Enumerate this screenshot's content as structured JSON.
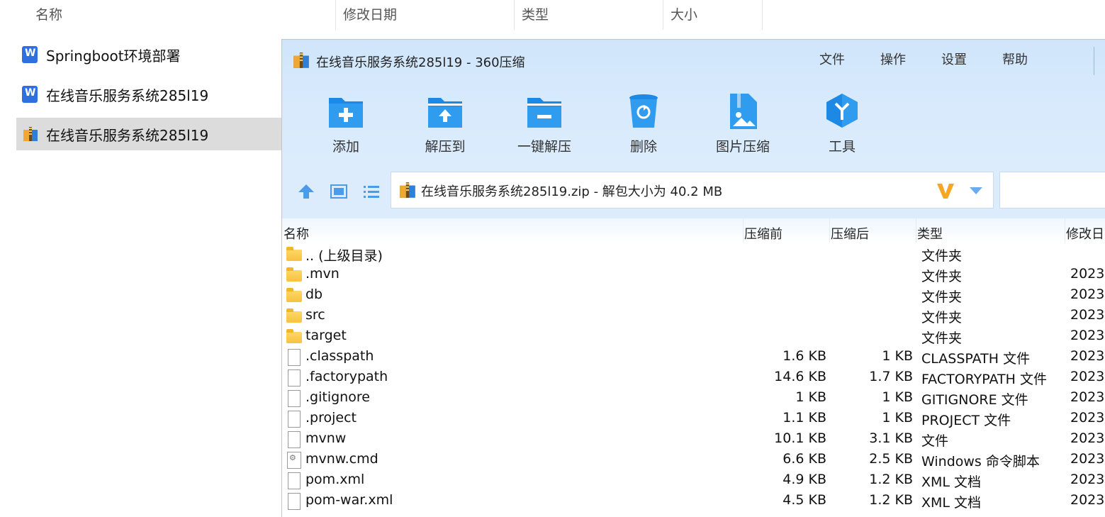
{
  "explorer": {
    "columns": {
      "name": "名称",
      "modified": "修改日期",
      "type": "类型",
      "size": "大小"
    },
    "items": [
      {
        "label": "Springboot环境部署",
        "icon": "wps-document-icon"
      },
      {
        "label": "在线音乐服务系统285l19",
        "icon": "wps-document-icon"
      },
      {
        "label": "在线音乐服务系统285l19",
        "icon": "zip-archive-icon"
      }
    ]
  },
  "window": {
    "title": "在线音乐服务系统285l19 - 360压缩",
    "menu": [
      "文件",
      "操作",
      "设置",
      "帮助"
    ],
    "toolbar": [
      {
        "label": "添加",
        "icon": "add-folder-icon"
      },
      {
        "label": "解压到",
        "icon": "extract-to-icon"
      },
      {
        "label": "一键解压",
        "icon": "one-click-extract-icon"
      },
      {
        "label": "删除",
        "icon": "recycle-bin-icon"
      },
      {
        "label": "图片压缩",
        "icon": "image-compress-icon"
      },
      {
        "label": "工具",
        "icon": "tools-icon"
      }
    ],
    "path": "在线音乐服务系统285l19.zip - 解包大小为 40.2 MB",
    "accent": "#1e88e5",
    "list_headers": {
      "name": "名称",
      "before": "压缩前",
      "after": "压缩后",
      "type": "类型",
      "modified": "修改日"
    },
    "files": [
      {
        "name": ".. (上级目录)",
        "size": "",
        "comp": "",
        "type": "文件夹",
        "date": "",
        "kind": "folder"
      },
      {
        "name": ".mvn",
        "size": "",
        "comp": "",
        "type": "文件夹",
        "date": "2023-",
        "kind": "folder"
      },
      {
        "name": "db",
        "size": "",
        "comp": "",
        "type": "文件夹",
        "date": "2023-",
        "kind": "folder"
      },
      {
        "name": "src",
        "size": "",
        "comp": "",
        "type": "文件夹",
        "date": "2023-",
        "kind": "folder"
      },
      {
        "name": "target",
        "size": "",
        "comp": "",
        "type": "文件夹",
        "date": "2023-",
        "kind": "folder"
      },
      {
        "name": ".classpath",
        "size": "1.6 KB",
        "comp": "1 KB",
        "type": "CLASSPATH 文件",
        "date": "2023-",
        "kind": "file"
      },
      {
        "name": ".factorypath",
        "size": "14.6 KB",
        "comp": "1.7 KB",
        "type": "FACTORYPATH 文件",
        "date": "2023-",
        "kind": "file"
      },
      {
        "name": ".gitignore",
        "size": "1 KB",
        "comp": "1 KB",
        "type": "GITIGNORE 文件",
        "date": "2023-",
        "kind": "file"
      },
      {
        "name": ".project",
        "size": "1.1 KB",
        "comp": "1 KB",
        "type": "PROJECT 文件",
        "date": "2023-",
        "kind": "file"
      },
      {
        "name": "mvnw",
        "size": "10.1 KB",
        "comp": "3.1 KB",
        "type": "文件",
        "date": "2023-",
        "kind": "file"
      },
      {
        "name": "mvnw.cmd",
        "size": "6.6 KB",
        "comp": "2.5 KB",
        "type": "Windows 命令脚本",
        "date": "2023-",
        "kind": "cmd"
      },
      {
        "name": "pom.xml",
        "size": "4.9 KB",
        "comp": "1.2 KB",
        "type": "XML 文档",
        "date": "2023-",
        "kind": "file"
      },
      {
        "name": "pom-war.xml",
        "size": "4.5 KB",
        "comp": "1.2 KB",
        "type": "XML 文档",
        "date": "2023-",
        "kind": "file"
      }
    ]
  }
}
